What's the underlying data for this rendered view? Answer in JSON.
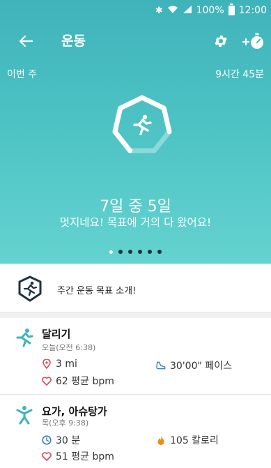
{
  "status_bar": {
    "battery": "100%",
    "time": "12:00"
  },
  "app_bar": {
    "title": "운동"
  },
  "summary": {
    "period_label": "이번 주",
    "total_duration": "9시간 45분",
    "goal_days": "7일 중 5일",
    "message": "멋지네요! 목표에 거의 다 왔어요!",
    "goal_fraction": 0.714
  },
  "pager": {
    "count": 6,
    "active_index": 0
  },
  "intro": {
    "text": "주간 운동 목표 소개!"
  },
  "activities": [
    {
      "name": "달리기",
      "time": "오늘(오전 6:38)",
      "stat1": "3 mi",
      "stat2": "30'00\" 페이스",
      "stat3": "62 평균 bpm"
    },
    {
      "name": "요가, 아슈탕가",
      "time": "목(오후 9:38)",
      "stat1": "30 분",
      "stat2": "105 칼로리",
      "stat3": "51 평균 bpm"
    }
  ],
  "colors": {
    "accent": "#3fb3ba",
    "badge_border": "#1f3340",
    "location": "#e0445c",
    "heart": "#e0445c",
    "clock": "#2f7fd0",
    "flame": "#f08a1c",
    "shoe": "#2f7fd0"
  }
}
